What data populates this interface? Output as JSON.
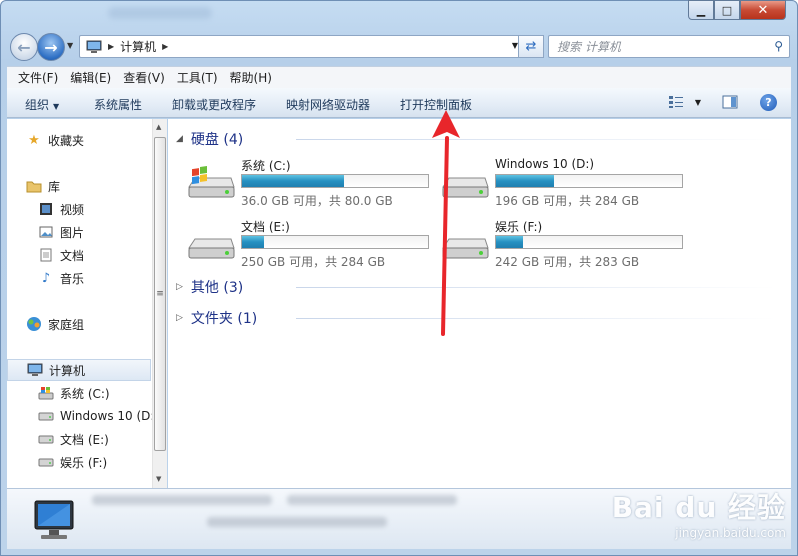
{
  "address": {
    "path": "计算机"
  },
  "search": {
    "placeholder": "搜索 计算机"
  },
  "menu": [
    "文件(F)",
    "编辑(E)",
    "查看(V)",
    "工具(T)",
    "帮助(H)"
  ],
  "toolbar": {
    "organize": "组织",
    "system_props": "系统属性",
    "uninstall": "卸载或更改程序",
    "map_drive": "映射网络驱动器",
    "control_panel": "打开控制面板"
  },
  "nav": {
    "favorites": "收藏夹",
    "libraries": "库",
    "videos": "视频",
    "pictures": "图片",
    "documents": "文档",
    "music": "音乐",
    "homegroup": "家庭组",
    "computer": "计算机",
    "drive_c": "系统 (C:)",
    "drive_d": "Windows 10 (D:",
    "drive_e": "文档 (E:)",
    "drive_f": "娱乐 (F:)"
  },
  "groups": {
    "hard_disks": "硬盘 (4)",
    "other": "其他 (3)",
    "folders": "文件夹 (1)"
  },
  "drives": [
    {
      "name": "系统 (C:)",
      "free": "36.0 GB 可用，共 80.0 GB",
      "used_fraction": 0.55
    },
    {
      "name": "Windows 10 (D:)",
      "free": "196 GB 可用，共 284 GB",
      "used_fraction": 0.31
    },
    {
      "name": "文档 (E:)",
      "free": "250 GB 可用，共 284 GB",
      "used_fraction": 0.12
    },
    {
      "name": "娱乐 (F:)",
      "free": "242 GB 可用，共 283 GB",
      "used_fraction": 0.145
    }
  ],
  "watermark": {
    "brand": "Bai du 经验",
    "url": "jingyan.baidu.com"
  },
  "colors": {
    "accent": "#1e3287",
    "arrow": "#e8262b",
    "bar_fill": "#2690c1"
  }
}
